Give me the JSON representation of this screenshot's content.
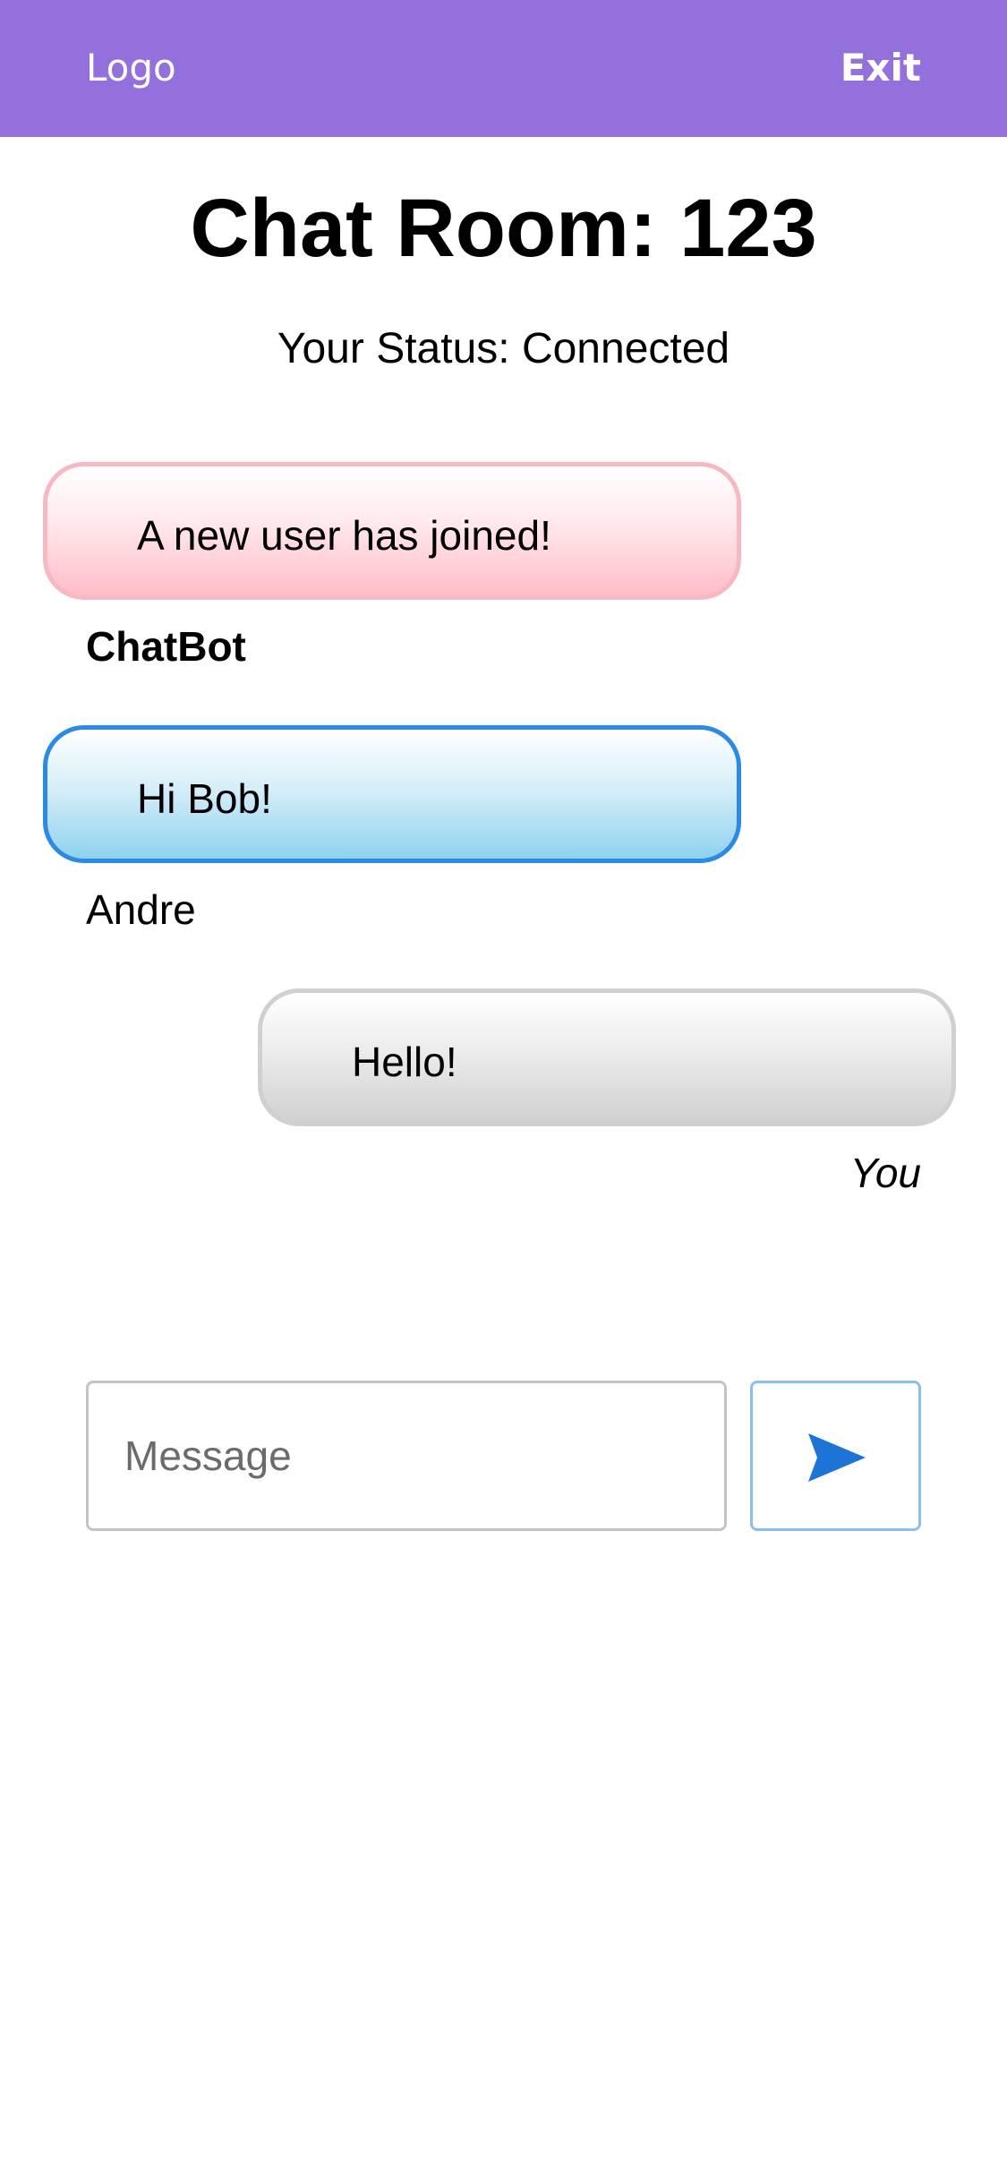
{
  "header": {
    "logo_label": "Logo",
    "exit_label": "Exit",
    "background_color": "#9370db"
  },
  "room": {
    "title": "Chat Room: 123",
    "status": "Your Status: Connected"
  },
  "messages": [
    {
      "text": "A new user has joined!",
      "sender": "ChatBot",
      "style": "bot",
      "border_color": "#f8b8c2"
    },
    {
      "text": "Hi Bob!",
      "sender": "Andre",
      "style": "other",
      "border_color": "#2a8ae6"
    },
    {
      "text": "Hello!",
      "sender": "You",
      "style": "self",
      "border_color": "#d0d0d0"
    }
  ],
  "composer": {
    "placeholder": "Message",
    "value": "",
    "send_icon": "send-icon",
    "send_icon_color": "#1e74d6"
  }
}
